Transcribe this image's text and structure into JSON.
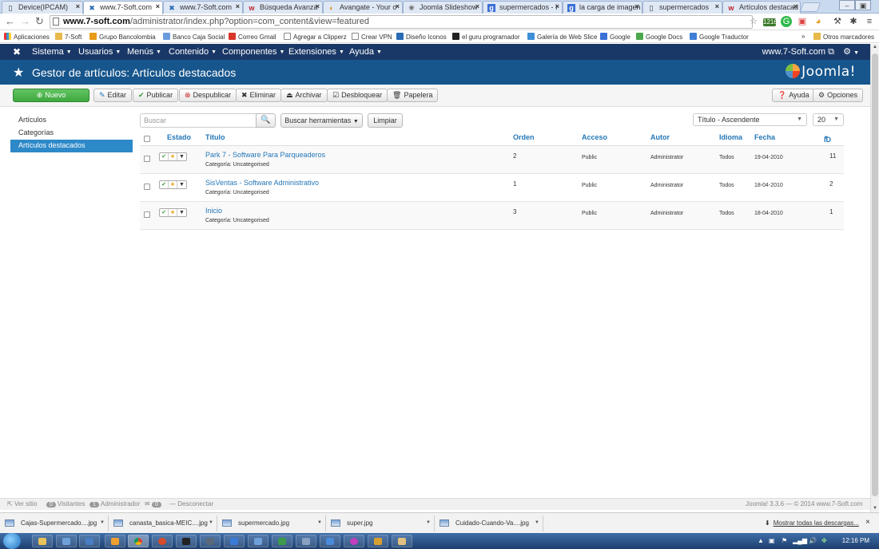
{
  "browser": {
    "tabs": [
      {
        "label": "Device(IPCAM)",
        "icon": "page-icon"
      },
      {
        "label": "www.7-Soft.com",
        "icon": "joomla-icon"
      },
      {
        "label": "www.7-Soft.com",
        "icon": "joomla-icon"
      },
      {
        "label": "Búsqueda Avanza",
        "icon": "w-icon"
      },
      {
        "label": "Avangate - Your o",
        "icon": "avangate-icon"
      },
      {
        "label": "Joomla Slideshow",
        "icon": "joomla-icon"
      },
      {
        "label": "supermercados - I",
        "icon": "google-icon"
      },
      {
        "label": "la carga de imagen",
        "icon": "google-icon"
      },
      {
        "label": "supermercados",
        "icon": "page-icon"
      },
      {
        "label": "Artículos destacad",
        "icon": "w-icon"
      }
    ],
    "url_host": "www.7-soft.com",
    "url_path": "/administrator/index.php?option=com_content&view=featured",
    "ext_badge": "1216",
    "bookmarks": [
      "Aplicaciones",
      "7-Soft",
      "Grupo Bancolombia",
      "Banco Caja Social",
      "Correo Gmail",
      "Agregar a Clipperz",
      "Crear VPN",
      "Diseño Iconos",
      "el guru programador",
      "Galería de Web Slice",
      "Google",
      "Google Docs",
      "Google Traductor"
    ],
    "bookmarks_overflow": "»",
    "other_bookmarks": "Otros marcadores"
  },
  "joomla": {
    "nav": [
      "Sistema",
      "Usuarios",
      "Menús",
      "Contenido",
      "Componentes",
      "Extensiones",
      "Ayuda"
    ],
    "site_link": "www.7-Soft.com",
    "page_title": "Gestor de artículos: Artículos destacados",
    "brand": "Joomla!",
    "toolbar": {
      "new": "Nuevo",
      "edit": "Editar",
      "publish": "Publicar",
      "unpublish": "Despublicar",
      "delete": "Eliminar",
      "archive": "Archivar",
      "unlock": "Desbloquear",
      "trash": "Papelera",
      "help": "Ayuda",
      "options": "Opciones"
    },
    "sidebar": [
      {
        "label": "Artículos",
        "active": false
      },
      {
        "label": "Categorías",
        "active": false
      },
      {
        "label": "Artículos destacados",
        "active": true
      }
    ],
    "filters": {
      "search_placeholder": "Buscar",
      "search_tools": "Buscar herramientas",
      "clear": "Limpiar",
      "ordering": "Título - Ascendente",
      "limit": "20"
    },
    "table": {
      "headers": {
        "status": "Estado",
        "title": "Título",
        "order": "Orden",
        "access": "Acceso",
        "author": "Autor",
        "language": "Idioma",
        "date": "Fecha",
        "id": "ID"
      },
      "rows": [
        {
          "title": "Park 7 - Software Para Parqueaderos",
          "category": "Categoría: Uncategorised",
          "order": "2",
          "access": "Public",
          "author": "Administrator",
          "language": "Todos",
          "date": "19-04-2010",
          "id": "11"
        },
        {
          "title": "SisVentas - Software Administrativo",
          "category": "Categoría: Uncategorised",
          "order": "1",
          "access": "Public",
          "author": "Administrator",
          "language": "Todos",
          "date": "18-04-2010",
          "id": "2"
        },
        {
          "title": "Inicio",
          "category": "Categoría: Uncategorised",
          "order": "3",
          "access": "Public",
          "author": "Administrator",
          "language": "Todos",
          "date": "18-04-2010",
          "id": "1"
        }
      ]
    },
    "footer": {
      "view_site": "Ver sitio",
      "visitors_count": "0",
      "visitors": "Visitantes",
      "admin_count": "1",
      "admin": "Administrador",
      "msg_count": "0",
      "logout": "Desconectar",
      "version": "Joomla! 3.3.6 — © 2014 www.7-Soft.com"
    }
  },
  "downloads": {
    "items": [
      "Cajas-Supermercado....jpg",
      "canasta_basica-MEIC....jpg",
      "supermercado.jpg",
      "super.jpg",
      "Cuidado-Cuando-Va....jpg"
    ],
    "show_all": "Mostrar todas las descargas...",
    "close": "×"
  },
  "taskbar": {
    "clock": "12:16 PM"
  },
  "colors": {
    "nav_bg": "#1a3867",
    "header_bg": "#17568c",
    "link": "#2477b8",
    "active_sidebar": "#2d89c8",
    "new_button": "#46a546"
  }
}
